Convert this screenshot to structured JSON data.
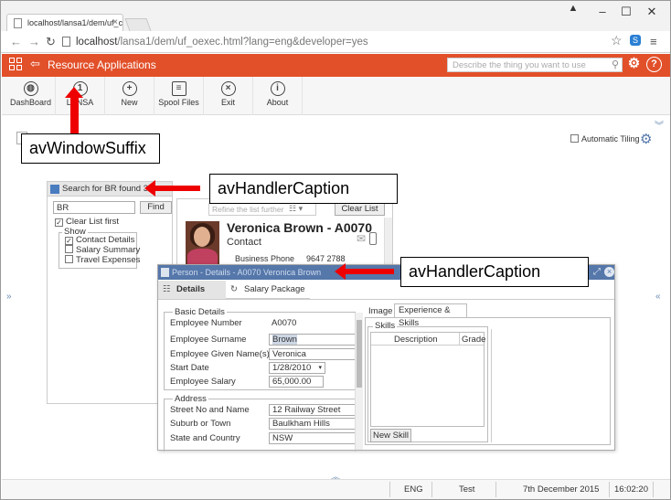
{
  "browser": {
    "tab_title": "localhost/lansa1/dem/uf_c",
    "url_host": "localhost",
    "url_path": "/lansa1/dem/uf_oexec.html?lang=eng&developer=yes"
  },
  "app": {
    "title": "Resource Applications",
    "search_placeholder": "Describe the thing you want to use",
    "accent": "#e2502a"
  },
  "toolbar": [
    {
      "label": "DashBoard",
      "icon": "globe-icon"
    },
    {
      "label": "LANSA",
      "icon": "lansa-icon",
      "badge": "1"
    },
    {
      "label": "New",
      "icon": "plus-icon"
    },
    {
      "label": "Spool Files",
      "icon": "document-icon"
    },
    {
      "label": "Exit",
      "icon": "close-icon"
    },
    {
      "label": "About",
      "icon": "info-icon"
    }
  ],
  "main": {
    "automatic_tiling": "Automatic Tiling"
  },
  "search_panel": {
    "caption": "Search for BR found 3",
    "search_value": "BR",
    "find_label": "Find",
    "clear_list_first": "Clear List first",
    "show_legend": "Show",
    "options": [
      {
        "label": "Contact Details",
        "checked": true
      },
      {
        "label": "Salary Summary",
        "checked": false
      },
      {
        "label": "Travel Expenses",
        "checked": false
      }
    ]
  },
  "result_panel": {
    "refine_placeholder": "Refine the list further",
    "clear_list": "Clear List",
    "name": "Veronica Brown - A0070",
    "subtitle": "Contact",
    "phone_label": "Business Phone",
    "phone_value": "9647 2788"
  },
  "details_panel": {
    "caption": "Person - Details - A0070 Veronica Brown",
    "tabs": [
      "Details",
      "Salary Package"
    ],
    "basic_legend": "Basic Details",
    "fields": [
      {
        "label": "Employee Number",
        "value": "A0070"
      },
      {
        "label": "Employee Surname",
        "value": "Brown"
      },
      {
        "label": "Employee Given Name(s)",
        "value": "Veronica"
      },
      {
        "label": "Start Date",
        "value": "1/28/2010"
      },
      {
        "label": "Employee Salary",
        "value": "65,000.00"
      }
    ],
    "address_legend": "Address",
    "address_fields": [
      {
        "label": "Street No and Name",
        "value": "12 Railway Street"
      },
      {
        "label": "Suburb or Town",
        "value": "Baulkham Hills"
      },
      {
        "label": "State and Country",
        "value": "NSW"
      }
    ],
    "right_tabs": [
      "Image",
      "Experience & Skills"
    ],
    "skills_legend": "Skills",
    "skills_columns": [
      "Description",
      "Grade"
    ],
    "new_skill": "New Skill"
  },
  "status": {
    "lang": "ENG",
    "env": "Test",
    "date": "7th December 2015",
    "time": "16:02:20"
  },
  "annotations": {
    "window_suffix": "avWindowSuffix",
    "handler_caption_1": "avHandlerCaption",
    "handler_caption_2": "avHandlerCaption",
    "arrow_color": "#e00000"
  }
}
